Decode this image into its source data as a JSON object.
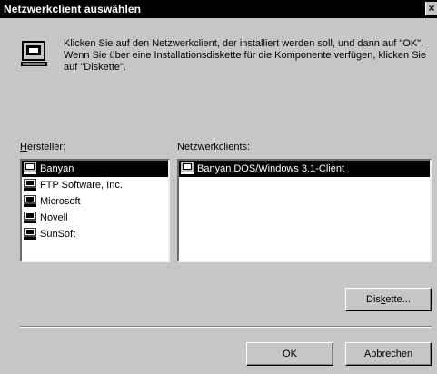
{
  "window": {
    "title": "Netzwerkclient auswählen",
    "close_glyph": "×"
  },
  "instruction": "Klicken Sie auf den Netzwerkclient, der installiert werden soll, und dann auf \"OK\". Wenn Sie über eine Installationsdiskette für die Komponente verfügen, klicken Sie auf \"Diskette\".",
  "manufacturers": {
    "label_prefix": "H",
    "label_rest": "ersteller:",
    "items": [
      {
        "label": "Banyan",
        "selected": true
      },
      {
        "label": "FTP Software, Inc.",
        "selected": false
      },
      {
        "label": "Microsoft",
        "selected": false
      },
      {
        "label": "Novell",
        "selected": false
      },
      {
        "label": "SunSoft",
        "selected": false
      }
    ]
  },
  "clients": {
    "label": "Netzwerkclients:",
    "items": [
      {
        "label": "Banyan DOS/Windows 3.1-Client",
        "selected": true
      }
    ]
  },
  "buttons": {
    "disk_pre": "Dis",
    "disk_u": "k",
    "disk_post": "ette...",
    "ok": "OK",
    "cancel": "Abbrechen"
  },
  "icons": {
    "dialog": "network-client-icon",
    "list_item": "computer-icon"
  }
}
